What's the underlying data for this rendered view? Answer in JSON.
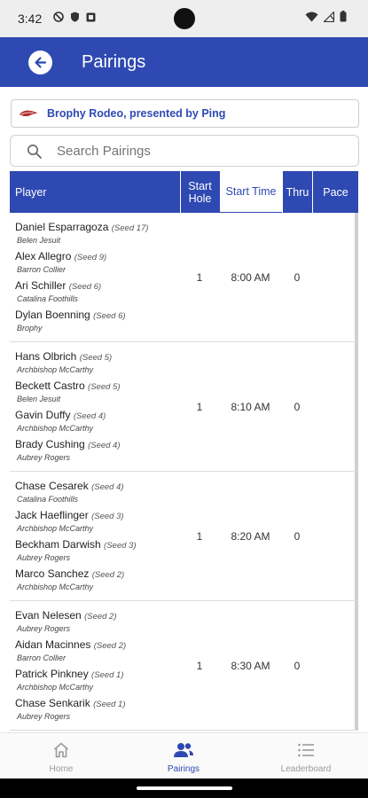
{
  "status_bar": {
    "time": "3:42"
  },
  "app_bar": {
    "title": "Pairings"
  },
  "event": {
    "name": "Brophy Rodeo, presented by Ping"
  },
  "search": {
    "placeholder": "Search Pairings"
  },
  "table": {
    "headers": {
      "player": "Player",
      "start_hole": "Start Hole",
      "start_time": "Start Time",
      "thru": "Thru",
      "pace": "Pace"
    },
    "groups": [
      {
        "players": [
          {
            "name": "Daniel Esparragoza",
            "seed": "(Seed 17)",
            "school": "Belen Jesuit"
          },
          {
            "name": "Alex Allegro",
            "seed": "(Seed 9)",
            "school": "Barron Collier"
          },
          {
            "name": "Ari Schiller",
            "seed": "(Seed 6)",
            "school": "Catalina Foothills"
          },
          {
            "name": "Dylan Boenning",
            "seed": "(Seed 6)",
            "school": "Brophy"
          }
        ],
        "start_hole": "1",
        "start_time": "8:00 AM",
        "thru": "0",
        "pace": ""
      },
      {
        "players": [
          {
            "name": "Hans Olbrich",
            "seed": "(Seed 5)",
            "school": "Archbishop McCarthy"
          },
          {
            "name": "Beckett Castro",
            "seed": "(Seed 5)",
            "school": "Belen Jesuit"
          },
          {
            "name": "Gavin Duffy",
            "seed": "(Seed 4)",
            "school": "Archbishop McCarthy"
          },
          {
            "name": "Brady Cushing",
            "seed": "(Seed 4)",
            "school": "Aubrey Rogers"
          }
        ],
        "start_hole": "1",
        "start_time": "8:10 AM",
        "thru": "0",
        "pace": ""
      },
      {
        "players": [
          {
            "name": "Chase Cesarek",
            "seed": "(Seed 4)",
            "school": "Catalina Foothills"
          },
          {
            "name": "Jack Haeflinger",
            "seed": "(Seed 3)",
            "school": "Archbishop McCarthy"
          },
          {
            "name": "Beckham Darwish",
            "seed": "(Seed 3)",
            "school": "Aubrey Rogers"
          },
          {
            "name": "Marco Sanchez",
            "seed": "(Seed 2)",
            "school": "Archbishop McCarthy"
          }
        ],
        "start_hole": "1",
        "start_time": "8:20 AM",
        "thru": "0",
        "pace": ""
      },
      {
        "players": [
          {
            "name": "Evan Nelesen",
            "seed": "(Seed 2)",
            "school": "Aubrey Rogers"
          },
          {
            "name": "Aidan Macinnes",
            "seed": "(Seed 2)",
            "school": "Barron Collier"
          },
          {
            "name": "Patrick Pinkney",
            "seed": "(Seed 1)",
            "school": "Archbishop McCarthy"
          },
          {
            "name": "Chase Senkarik",
            "seed": "(Seed 1)",
            "school": "Aubrey Rogers"
          }
        ],
        "start_hole": "1",
        "start_time": "8:30 AM",
        "thru": "0",
        "pace": ""
      }
    ]
  },
  "bottom_nav": [
    {
      "label": "Home",
      "icon": "home-icon",
      "active": false
    },
    {
      "label": "Pairings",
      "icon": "people-icon",
      "active": true
    },
    {
      "label": "Leaderboard",
      "icon": "list-icon",
      "active": false
    }
  ],
  "colors": {
    "brand": "#2f49b3",
    "nav_inactive": "#9a9a9a"
  }
}
